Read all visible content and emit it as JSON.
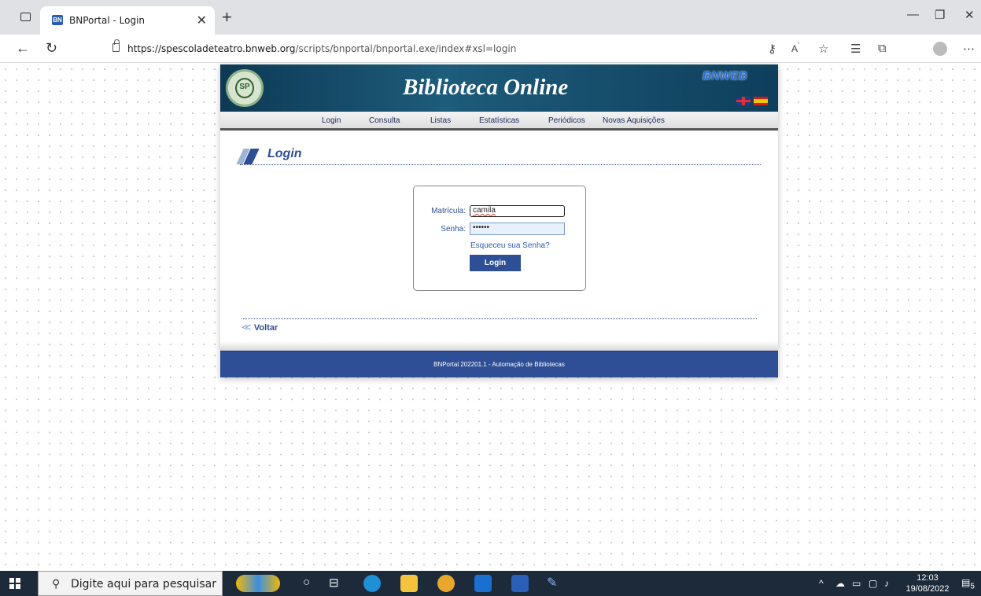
{
  "browser": {
    "tab_title": "BNPortal - Login",
    "tab_favicon": "BN",
    "tab_close": "✕",
    "new_tab": "+",
    "url_domain": "https://spescoladeteatro.bnweb.org",
    "url_path": "/scripts/bnportal/bnportal.exe/index#xsl=login",
    "icons": [
      "back-icon",
      "refresh-icon",
      "lock-icon",
      "key-icon",
      "read-aloud-icon",
      "favorites-add-icon",
      "favorites-icon",
      "collections-icon",
      "profile-icon",
      "more-icon"
    ]
  },
  "portal": {
    "banner_title": "Biblioteca Online",
    "bnweb_logo": "BNWEB",
    "logo_text": "SP",
    "menu": [
      "Login",
      "Consulta",
      "Listas",
      "Estatísticas",
      "Periódicos",
      "Novas Aquisições"
    ],
    "section_title": "Login",
    "form": {
      "matricula_label": "Matrícula:",
      "matricula_value": "camila",
      "senha_label": "Senha:",
      "senha_value": "••••••",
      "forgot_link": "Esqueceu sua Senha?",
      "login_button": "Login"
    },
    "back_label": "Voltar",
    "back_arrow": "≪",
    "footer": "BNPortal 202201.1 - Automação de Bibliotecas"
  },
  "taskbar": {
    "search_placeholder": "Digite aqui para pesquisar",
    "time": "12:03",
    "date": "19/08/2022",
    "notification_count": "5",
    "colors": {
      "edge": "#1f8fd6",
      "explorer": "#f5c43d",
      "chrome": "#e8a72a",
      "outlook": "#1b6fd0",
      "word": "#2b5fb8"
    }
  }
}
